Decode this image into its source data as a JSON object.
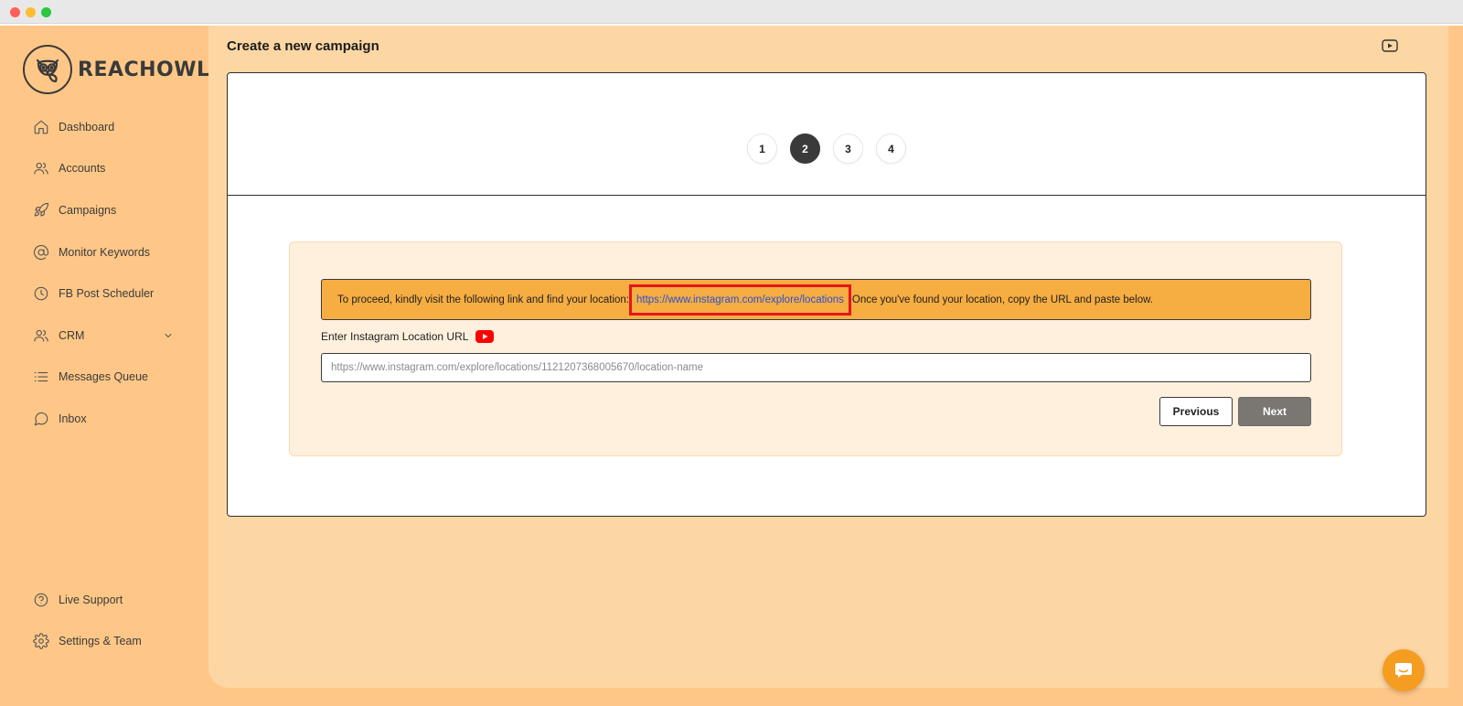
{
  "brand": {
    "name": "REACHOWL"
  },
  "sidebar": {
    "items": [
      {
        "label": "Dashboard",
        "icon": "home-icon"
      },
      {
        "label": "Accounts",
        "icon": "users-icon"
      },
      {
        "label": "Campaigns",
        "icon": "rocket-icon"
      },
      {
        "label": "Monitor Keywords",
        "icon": "at-sign-icon"
      },
      {
        "label": "FB Post Scheduler",
        "icon": "clock-icon"
      },
      {
        "label": "CRM",
        "icon": "users-icon",
        "expandable": true
      },
      {
        "label": "Messages Queue",
        "icon": "list-icon"
      },
      {
        "label": "Inbox",
        "icon": "chat-icon"
      }
    ],
    "bottom_items": [
      {
        "label": "Live Support",
        "icon": "help-circle-icon"
      },
      {
        "label": "Settings & Team",
        "icon": "gear-icon"
      }
    ]
  },
  "header": {
    "title": "Create a new campaign"
  },
  "stepper": {
    "steps": [
      "1",
      "2",
      "3",
      "4"
    ],
    "active_step": 2
  },
  "notice": {
    "prefix": "To proceed, kindly visit the following link and find your location:",
    "link_text": "https://www.instagram.com/explore/locations",
    "suffix": "Once you've found your location, copy the URL and paste below."
  },
  "form": {
    "label": "Enter Instagram Location URL",
    "placeholder": "https://www.instagram.com/explore/locations/1121207368005670/location-name",
    "value": ""
  },
  "buttons": {
    "previous": "Previous",
    "next": "Next"
  },
  "colors": {
    "sidebar_bg": "#ffc787",
    "main_bg": "#fdd7a3",
    "notice_bg": "#f6ad42",
    "form_box_bg": "#fff0de",
    "active_step": "#3a3a3a",
    "next_button": "#7a7671",
    "link": "#2a4fd6",
    "highlight": "#e5161b",
    "chat_bubble": "#f59d21"
  }
}
